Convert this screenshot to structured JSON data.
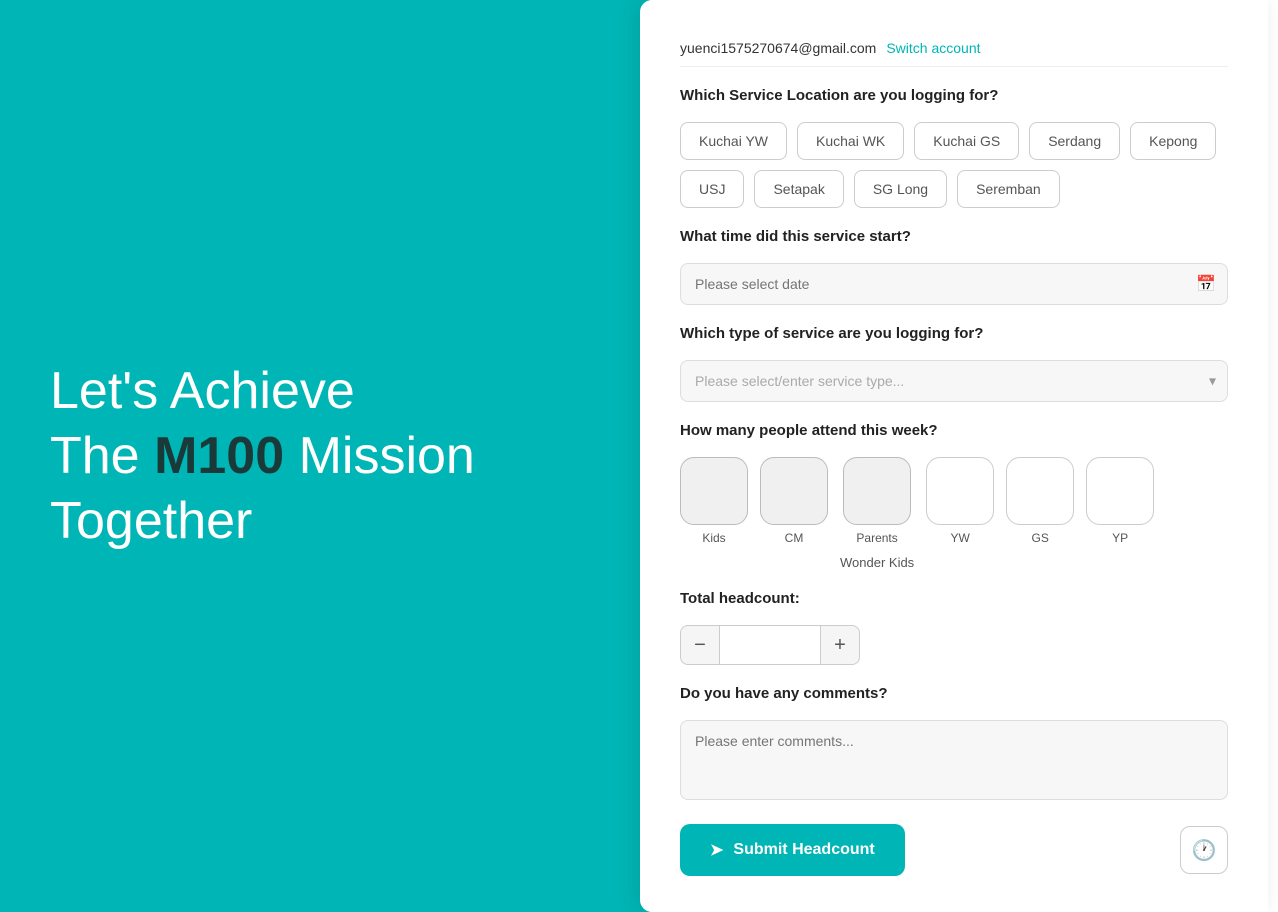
{
  "left": {
    "line1": "Let's Achieve",
    "line2_pre": "The ",
    "line2_bold": "M100",
    "line2_post": " Mission",
    "line3": "Together"
  },
  "header": {
    "email": "yuenci1575270674@gmail.com",
    "switch_label": "Switch account"
  },
  "service_location": {
    "label": "Which Service Location are you logging for?",
    "options": [
      "Kuchai YW",
      "Kuchai WK",
      "Kuchai GS",
      "Serdang",
      "Kepong",
      "USJ",
      "Setapak",
      "SG Long",
      "Seremban"
    ]
  },
  "service_time": {
    "label": "What time did this service start?",
    "placeholder": "Please select date"
  },
  "service_type": {
    "label": "Which type of service are you logging for?",
    "placeholder": "Please select/enter service type..."
  },
  "attendance": {
    "label": "How many people attend this week?",
    "counters": [
      {
        "id": "kids",
        "label": "Kids"
      },
      {
        "id": "cm",
        "label": "CM"
      },
      {
        "id": "parents",
        "label": "Parents"
      },
      {
        "id": "yw",
        "label": "YW"
      },
      {
        "id": "gs",
        "label": "GS"
      },
      {
        "id": "yp",
        "label": "YP"
      }
    ],
    "wonder_kids_label": "Wonder Kids"
  },
  "total_headcount": {
    "label": "Total headcount:",
    "minus_label": "−",
    "plus_label": "+",
    "value": ""
  },
  "comments": {
    "label": "Do you have any comments?",
    "placeholder": "Please enter comments..."
  },
  "submit": {
    "label": "Submit Headcount"
  },
  "colors": {
    "teal": "#00b5b5",
    "dark_text": "#1a3a3a"
  }
}
